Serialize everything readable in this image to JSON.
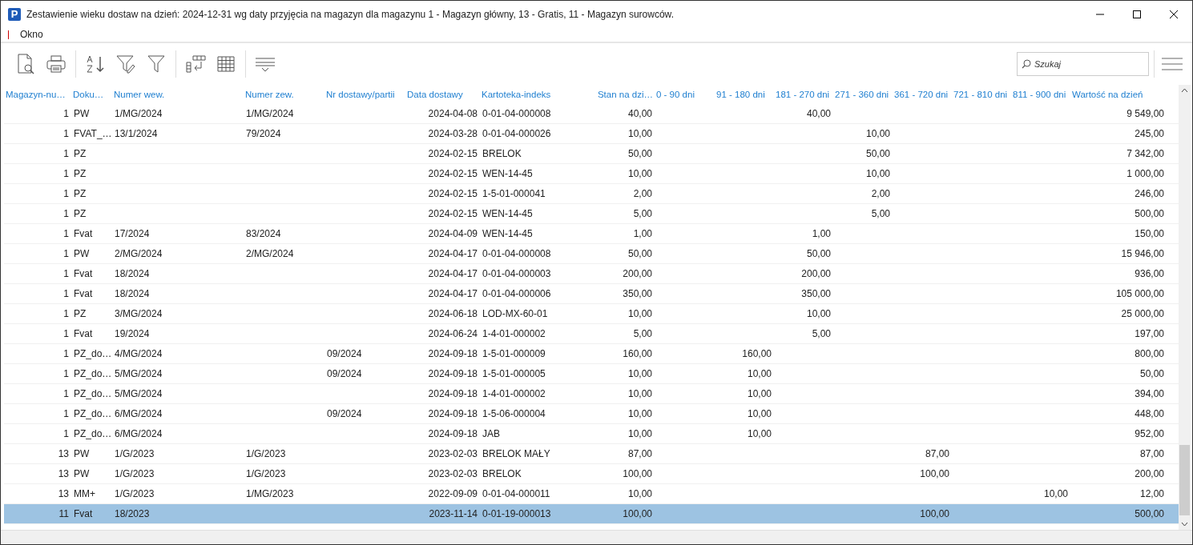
{
  "window": {
    "icon_letter": "P",
    "title": "Zestawienie wieku dostaw na dzień: 2024-12-31 wg daty przyjęcia na magazyn dla magazynu 1 - Magazyn główny, 13 - Gratis, 11 - Magazyn surowców."
  },
  "menu": [
    "Okno"
  ],
  "search": {
    "placeholder": "Szukaj"
  },
  "table": {
    "columns": [
      "Magazyn-nu…",
      "Doku…",
      "Numer wew.",
      "Numer zew.",
      "Nr dostawy/partii",
      "Data dostawy",
      "Kartoteka-indeks",
      "Stan na dzi…",
      "0 - 90 dni",
      "91 - 180 dni",
      "181 - 270 dni",
      "271 - 360 dni",
      "361 - 720 dni",
      "721 - 810 dni",
      "811 - 900 dni",
      "Wartość na dzień"
    ],
    "rows": [
      {
        "selected": false,
        "cells": [
          "1",
          "PW",
          "1/MG/2024",
          "1/MG/2024",
          "",
          "2024-04-08",
          "0-01-04-000008",
          "40,00",
          "",
          "",
          "40,00",
          "",
          "",
          "",
          "",
          "9 549,00"
        ]
      },
      {
        "selected": false,
        "cells": [
          "1",
          "FVAT_…",
          "13/1/2024",
          "79/2024",
          "",
          "2024-03-28",
          "0-01-04-000026",
          "10,00",
          "",
          "",
          "",
          "10,00",
          "",
          "",
          "",
          "245,00"
        ]
      },
      {
        "selected": false,
        "cells": [
          "1",
          "PZ",
          "",
          "",
          "",
          "2024-02-15",
          "BRELOK",
          "50,00",
          "",
          "",
          "",
          "50,00",
          "",
          "",
          "",
          "7 342,00"
        ]
      },
      {
        "selected": false,
        "cells": [
          "1",
          "PZ",
          "",
          "",
          "",
          "2024-02-15",
          "WEN-14-45",
          "10,00",
          "",
          "",
          "",
          "10,00",
          "",
          "",
          "",
          "1 000,00"
        ]
      },
      {
        "selected": false,
        "cells": [
          "1",
          "PZ",
          "",
          "",
          "",
          "2024-02-15",
          "1-5-01-000041",
          "2,00",
          "",
          "",
          "",
          "2,00",
          "",
          "",
          "",
          "246,00"
        ]
      },
      {
        "selected": false,
        "cells": [
          "1",
          "PZ",
          "",
          "",
          "",
          "2024-02-15",
          "WEN-14-45",
          "5,00",
          "",
          "",
          "",
          "5,00",
          "",
          "",
          "",
          "500,00"
        ]
      },
      {
        "selected": false,
        "cells": [
          "1",
          "Fvat",
          "17/2024",
          "83/2024",
          "",
          "2024-04-09",
          "WEN-14-45",
          "1,00",
          "",
          "",
          "1,00",
          "",
          "",
          "",
          "",
          "150,00"
        ]
      },
      {
        "selected": false,
        "cells": [
          "1",
          "PW",
          "2/MG/2024",
          "2/MG/2024",
          "",
          "2024-04-17",
          "0-01-04-000008",
          "50,00",
          "",
          "",
          "50,00",
          "",
          "",
          "",
          "",
          "15 946,00"
        ]
      },
      {
        "selected": false,
        "cells": [
          "1",
          "Fvat",
          "18/2024",
          "",
          "",
          "2024-04-17",
          "0-01-04-000003",
          "200,00",
          "",
          "",
          "200,00",
          "",
          "",
          "",
          "",
          "936,00"
        ]
      },
      {
        "selected": false,
        "cells": [
          "1",
          "Fvat",
          "18/2024",
          "",
          "",
          "2024-04-17",
          "0-01-04-000006",
          "350,00",
          "",
          "",
          "350,00",
          "",
          "",
          "",
          "",
          "105 000,00"
        ]
      },
      {
        "selected": false,
        "cells": [
          "1",
          "PZ",
          "3/MG/2024",
          "",
          "",
          "2024-06-18",
          "LOD-MX-60-01",
          "10,00",
          "",
          "",
          "10,00",
          "",
          "",
          "",
          "",
          "25 000,00"
        ]
      },
      {
        "selected": false,
        "cells": [
          "1",
          "Fvat",
          "19/2024",
          "",
          "",
          "2024-06-24",
          "1-4-01-000002",
          "5,00",
          "",
          "",
          "5,00",
          "",
          "",
          "",
          "",
          "197,00"
        ]
      },
      {
        "selected": false,
        "cells": [
          "1",
          "PZ_do…",
          "4/MG/2024",
          "",
          "09/2024",
          "2024-09-18",
          "1-5-01-000009",
          "160,00",
          "",
          "160,00",
          "",
          "",
          "",
          "",
          "",
          "800,00"
        ]
      },
      {
        "selected": false,
        "cells": [
          "1",
          "PZ_do…",
          "5/MG/2024",
          "",
          "09/2024",
          "2024-09-18",
          "1-5-01-000005",
          "10,00",
          "",
          "10,00",
          "",
          "",
          "",
          "",
          "",
          "50,00"
        ]
      },
      {
        "selected": false,
        "cells": [
          "1",
          "PZ_do…",
          "5/MG/2024",
          "",
          "",
          "2024-09-18",
          "1-4-01-000002",
          "10,00",
          "",
          "10,00",
          "",
          "",
          "",
          "",
          "",
          "394,00"
        ]
      },
      {
        "selected": false,
        "cells": [
          "1",
          "PZ_do…",
          "6/MG/2024",
          "",
          "09/2024",
          "2024-09-18",
          "1-5-06-000004",
          "10,00",
          "",
          "10,00",
          "",
          "",
          "",
          "",
          "",
          "448,00"
        ]
      },
      {
        "selected": false,
        "cells": [
          "1",
          "PZ_do…",
          "6/MG/2024",
          "",
          "",
          "2024-09-18",
          "JAB",
          "10,00",
          "",
          "10,00",
          "",
          "",
          "",
          "",
          "",
          "952,00"
        ]
      },
      {
        "selected": false,
        "cells": [
          "13",
          "PW",
          "1/G/2023",
          "1/G/2023",
          "",
          "2023-02-03",
          "BRELOK MAŁY",
          "87,00",
          "",
          "",
          "",
          "",
          "87,00",
          "",
          "",
          "87,00"
        ]
      },
      {
        "selected": false,
        "cells": [
          "13",
          "PW",
          "1/G/2023",
          "1/G/2023",
          "",
          "2023-02-03",
          "BRELOK",
          "100,00",
          "",
          "",
          "",
          "",
          "100,00",
          "",
          "",
          "200,00"
        ]
      },
      {
        "selected": false,
        "cells": [
          "13",
          "MM+",
          "1/G/2023",
          "1/MG/2023",
          "",
          "2022-09-09",
          "0-01-04-000011",
          "10,00",
          "",
          "",
          "",
          "",
          "",
          "",
          "10,00",
          "12,00"
        ]
      },
      {
        "selected": true,
        "cells": [
          "11",
          "Fvat",
          "18/2023",
          "",
          "",
          "2023-11-14",
          "0-01-19-000013",
          "100,00",
          "",
          "",
          "",
          "",
          "100,00",
          "",
          "",
          "500,00"
        ]
      }
    ]
  }
}
